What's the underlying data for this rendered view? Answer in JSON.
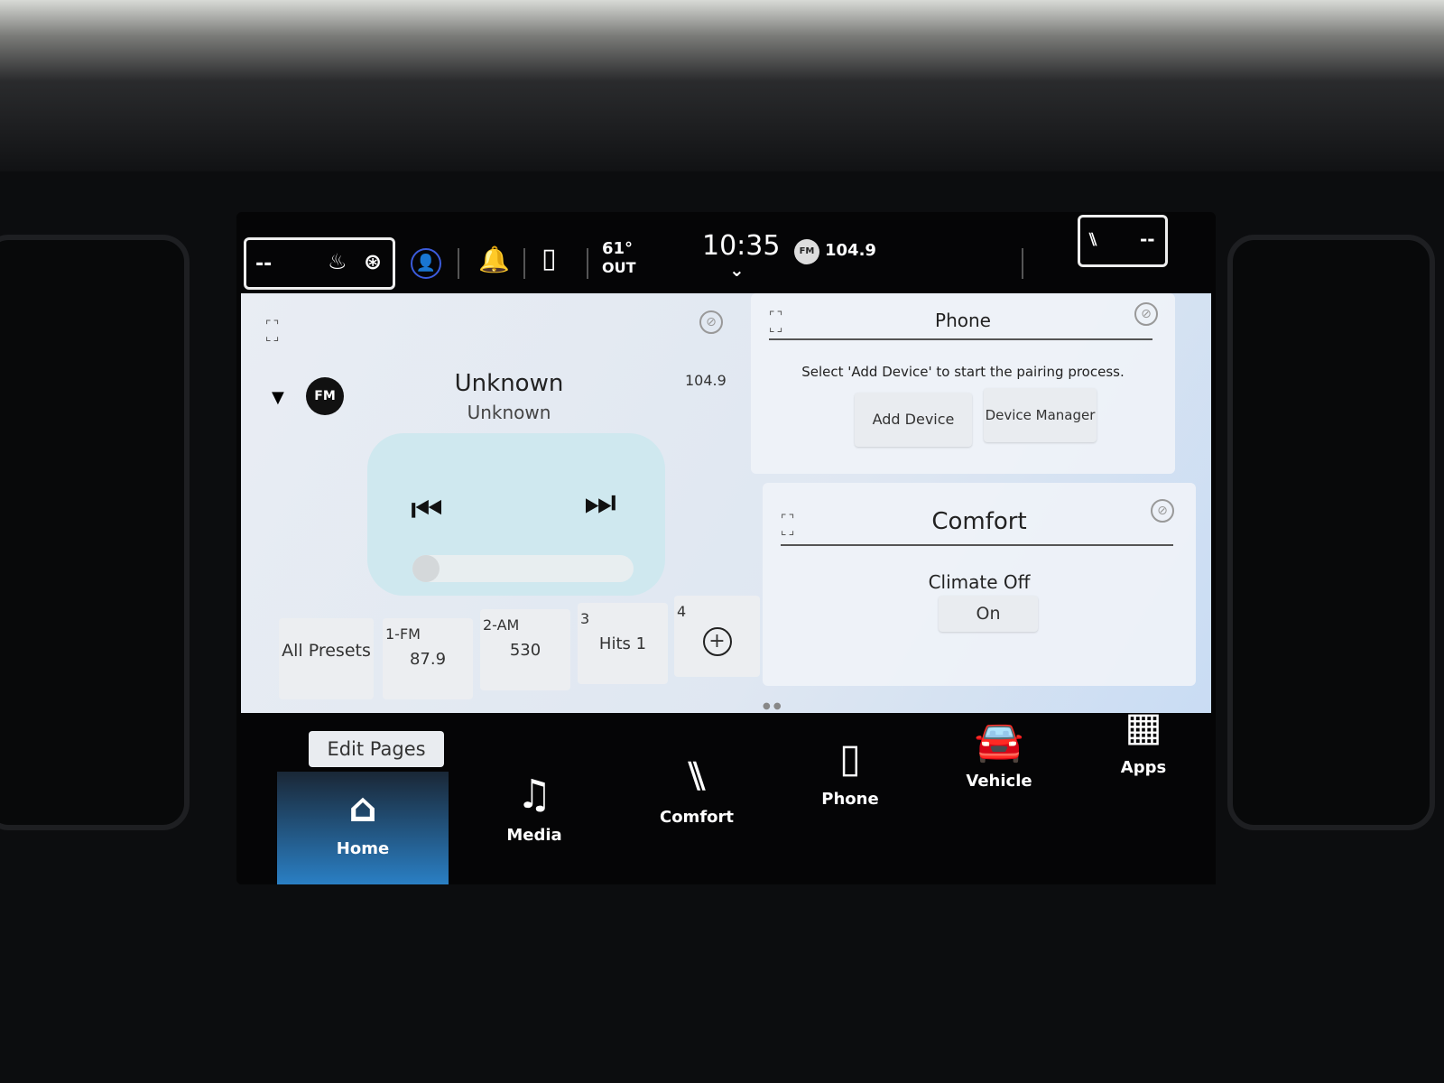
{
  "status": {
    "left_temp": "--",
    "right_temp": "--",
    "outside_temp": "61°",
    "outside_label": "OUT",
    "time": "10:35",
    "radio_badge": "FM",
    "radio_freq": "104.9"
  },
  "radio": {
    "band": "FM",
    "title": "Unknown",
    "subtitle": "Unknown",
    "frequency": "104.9",
    "presets": [
      {
        "label": "All Presets"
      },
      {
        "num": "1-FM",
        "value": "87.9"
      },
      {
        "num": "2-AM",
        "value": "530"
      },
      {
        "num": "3",
        "value": "Hits 1"
      },
      {
        "num": "4",
        "value": ""
      }
    ]
  },
  "phone": {
    "title": "Phone",
    "message": "Select 'Add Device' to start the pairing process.",
    "add_device": "Add Device",
    "device_manager": "Device Manager"
  },
  "comfort": {
    "title": "Comfort",
    "climate_status": "Climate Off",
    "on_button": "On"
  },
  "edit_pages": "Edit Pages",
  "nav": [
    {
      "label": "Home",
      "icon": "home-icon",
      "active": true
    },
    {
      "label": "Media",
      "icon": "music-note-icon"
    },
    {
      "label": "Comfort",
      "icon": "seat-icon"
    },
    {
      "label": "Phone",
      "icon": "phone-icon"
    },
    {
      "label": "Vehicle",
      "icon": "car-icon"
    },
    {
      "label": "Apps",
      "icon": "grid-icon"
    }
  ],
  "colors": {
    "accent": "#2a7fc4",
    "user_icon": "#3b5bdb"
  }
}
